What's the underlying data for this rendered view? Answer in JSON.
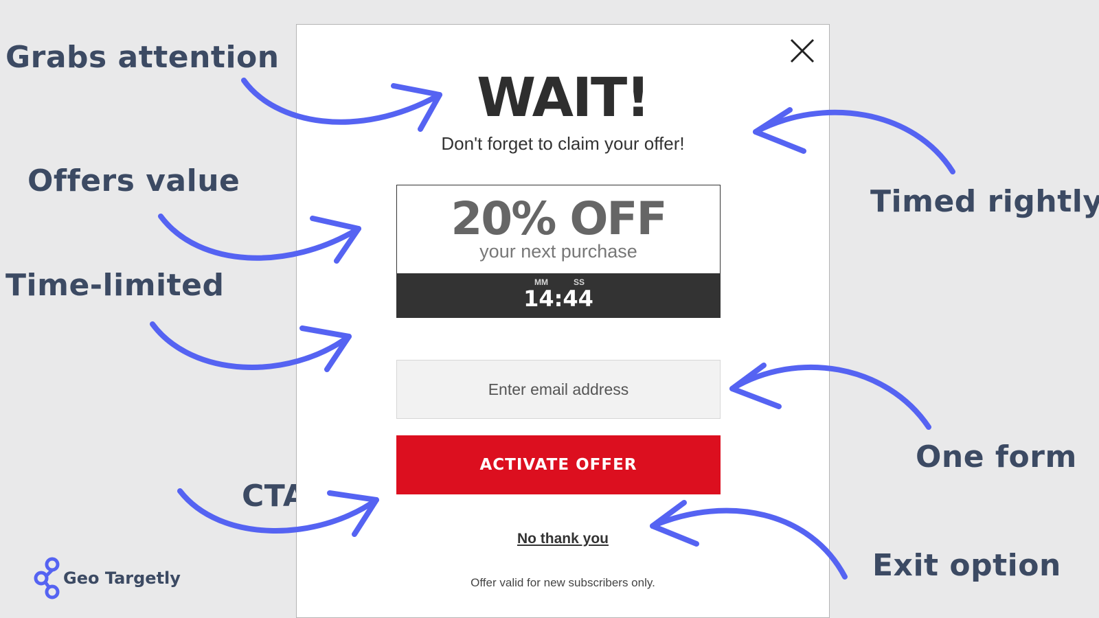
{
  "annotations": {
    "grabs_attention": "Grabs attention",
    "offers_value": "Offers value",
    "time_limited": "Time-limited",
    "cta": "CTA",
    "timed_rightly": "Timed rightly",
    "one_form": "One form",
    "exit_option": "Exit option"
  },
  "popup": {
    "title": "WAIT!",
    "subtitle": "Don't forget to claim your offer!",
    "offer": {
      "amount": "20% OFF",
      "subtitle": "your next purchase"
    },
    "timer": {
      "mm_label": "MM",
      "ss_label": "SS",
      "value": "14:44"
    },
    "email_placeholder": "Enter email address",
    "cta_label": "ACTIVATE OFFER",
    "decline_label": "No thank you",
    "disclaimer": "Offer valid for new subscribers only."
  },
  "brand": {
    "name": "Geo Targetly"
  },
  "icons": {
    "close": "close-icon",
    "logo": "location-pins-logo-icon",
    "arrow": "curved-arrow-icon"
  },
  "colors": {
    "annotation_text": "#3c4a63",
    "arrow": "#5563f2",
    "cta_background": "#dc0f1f",
    "timer_background": "#333333",
    "page_background": "#e9e9ea"
  }
}
